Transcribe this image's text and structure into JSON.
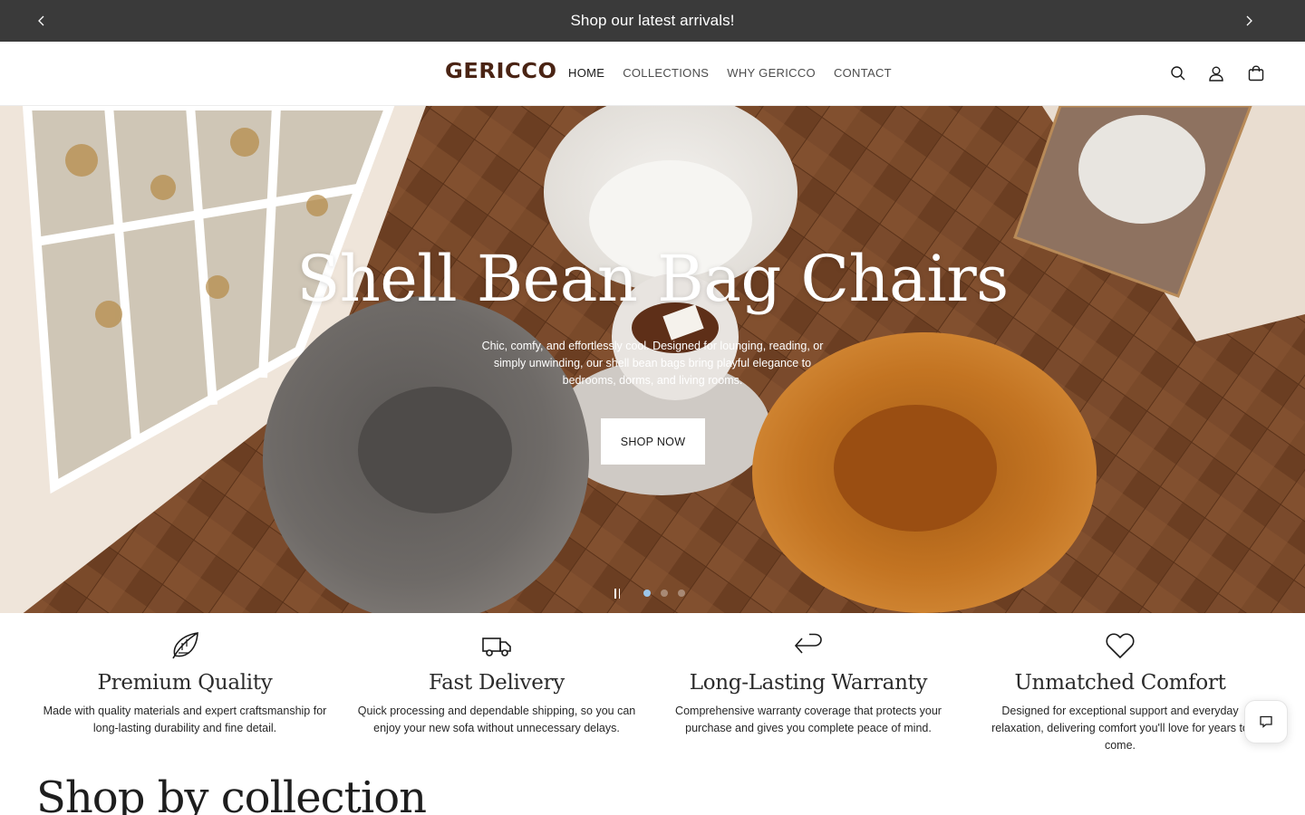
{
  "announcement": {
    "text": "Shop our latest arrivals!",
    "prev_icon": "chevron-left-icon",
    "next_icon": "chevron-right-icon"
  },
  "header": {
    "logo": "GERICCO",
    "nav": [
      {
        "label": "HOME",
        "active": true
      },
      {
        "label": "COLLECTIONS",
        "active": false
      },
      {
        "label": "WHY GERICCO",
        "active": false
      },
      {
        "label": "CONTACT",
        "active": false
      }
    ],
    "icons": [
      "search-icon",
      "account-icon",
      "cart-icon"
    ]
  },
  "hero": {
    "title": "Shell Bean Bag Chairs",
    "subtitle": "Chic, comfy, and effortlessly cool. Designed for lounging, reading, or simply unwinding, our shell bean bags bring playful elegance to bedrooms, dorms, and living rooms.",
    "button_label": "SHOP NOW",
    "slide_count": 3,
    "active_slide": 1
  },
  "features": [
    {
      "icon": "leaf-icon",
      "title": "Premium Quality",
      "desc": "Made with quality materials and expert craftsmanship for long-lasting durability and fine detail."
    },
    {
      "icon": "truck-icon",
      "title": "Fast Delivery",
      "desc": "Quick processing and dependable shipping, so you can enjoy your new sofa without unnecessary delays."
    },
    {
      "icon": "return-arrow-icon",
      "title": "Long-Lasting Warranty",
      "desc": "Comprehensive warranty coverage that protects your purchase and gives you complete peace of mind."
    },
    {
      "icon": "heart-icon",
      "title": "Unmatched Comfort",
      "desc": "Designed for exceptional support and everyday relaxation, delivering comfort you'll love for years to come."
    }
  ],
  "collection_heading": "Shop by collection",
  "colors": {
    "announcement_bg": "#3a3a3a",
    "logo": "#4a2414",
    "active_dot": "#9cc6ea"
  }
}
